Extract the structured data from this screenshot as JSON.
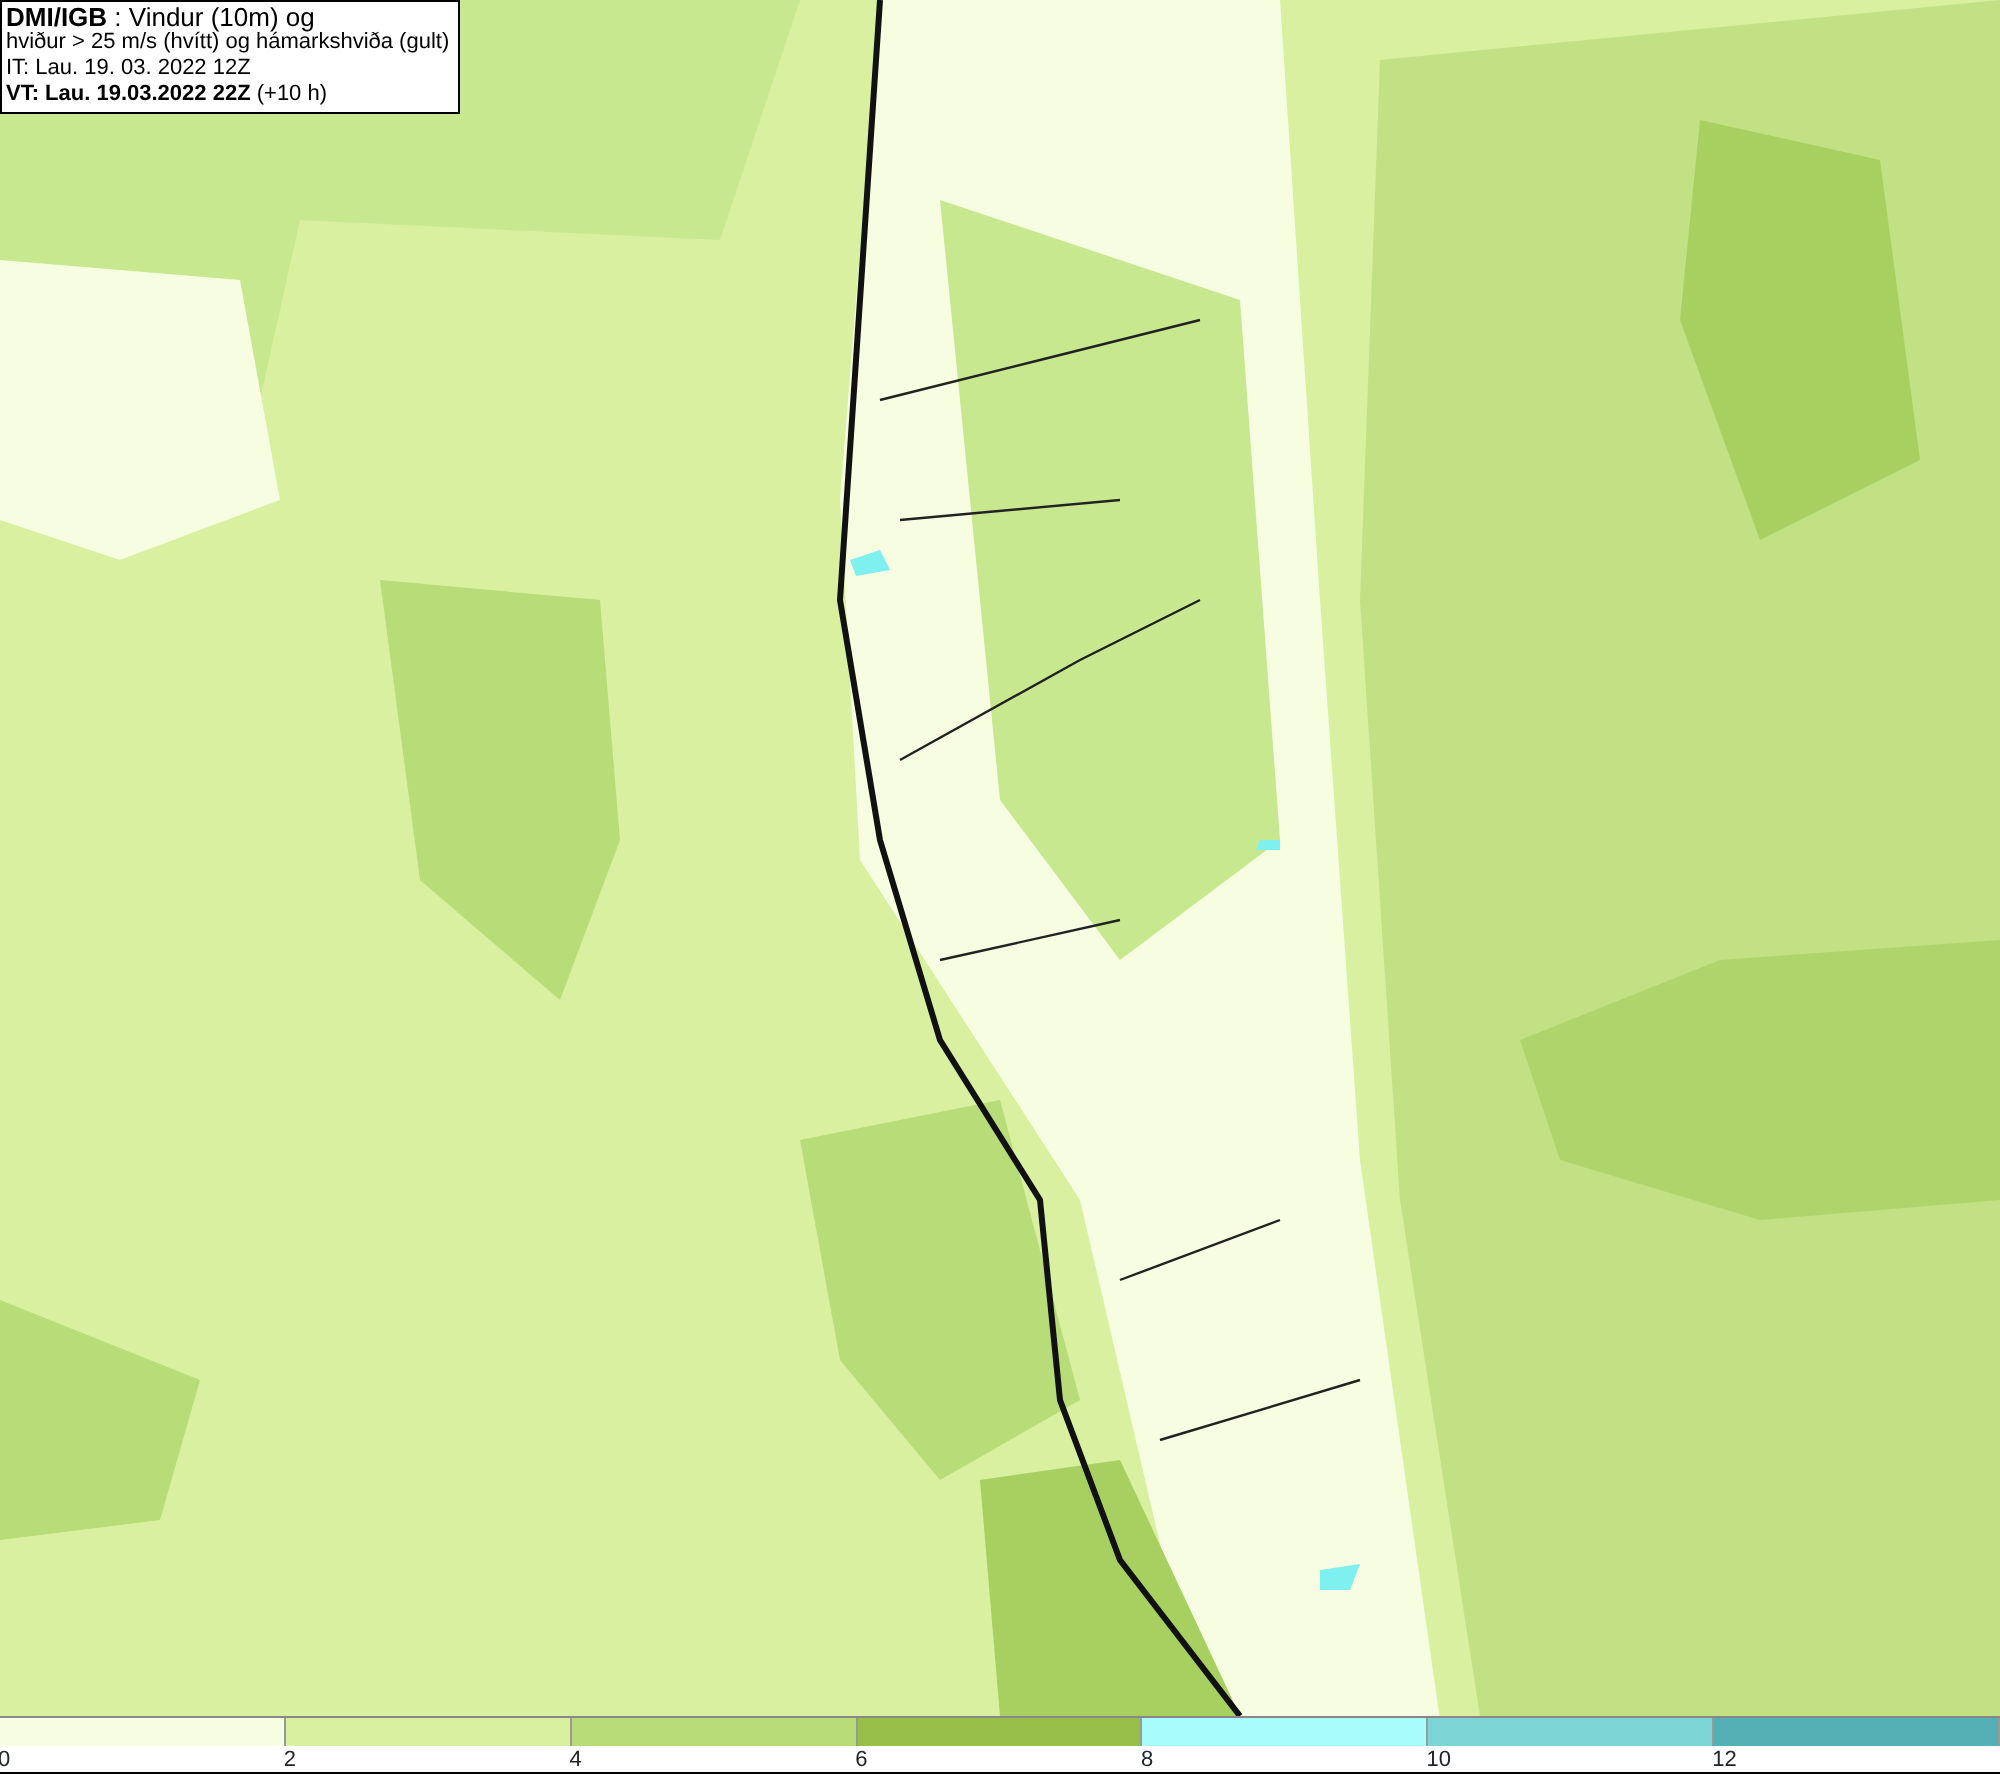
{
  "title_box": {
    "lines": [
      "**DMI/IGB** : Vindur (10m) og",
      "hviður > 25 m/s (hvítt) og hámarkshviða (gult)",
      "IT: Lau. 19. 03. 2022 12Z",
      "**VT: Lau. 19.03.2022 22Z** (+10 h)"
    ]
  },
  "legend": [
    {
      "label": "0",
      "color": "#f7fde0"
    },
    {
      "label": "2",
      "color": "#d8f0a0"
    },
    {
      "label": "4",
      "color": "#b8dc78"
    },
    {
      "label": "6",
      "color": "#98c048"
    },
    {
      "label": "8",
      "color": "#a8fcfc"
    },
    {
      "label": "10",
      "color": "#7cd4d4"
    },
    {
      "label": "12",
      "color": "#54b0b4"
    }
  ]
}
